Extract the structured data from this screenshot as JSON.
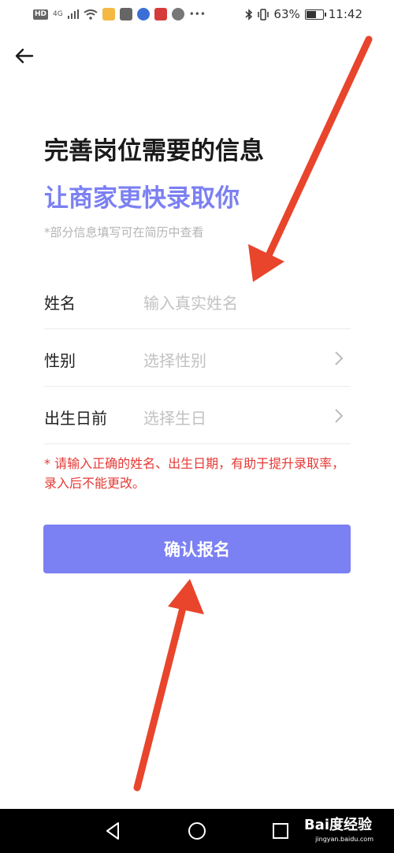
{
  "status_bar": {
    "hd_label": "HD",
    "network_label": "4G",
    "battery_text": "63%",
    "battery_level": 0.63,
    "time": "11:42"
  },
  "header": {
    "back_icon": "arrow-left-icon"
  },
  "page": {
    "title": "完善岗位需要的信息",
    "subtitle": "让商家更快录取你",
    "hint": "*部分信息填写可在简历中查看"
  },
  "form": {
    "rows": [
      {
        "label": "姓名",
        "placeholder": "输入真实姓名",
        "has_chevron": false
      },
      {
        "label": "性别",
        "placeholder": "选择性别",
        "has_chevron": true
      },
      {
        "label": "出生日前",
        "placeholder": "选择生日",
        "has_chevron": true
      }
    ]
  },
  "notice": "* 请输入正确的姓名、出生日期，有助于提升录取率，录入后不能更改。",
  "submit_label": "确认报名",
  "colors": {
    "accent": "#7b80f2",
    "warning": "#e53935",
    "annotation": "#e8452c"
  },
  "watermark": {
    "brand": "Bai度经验",
    "url": "jingyan.baidu.com"
  }
}
